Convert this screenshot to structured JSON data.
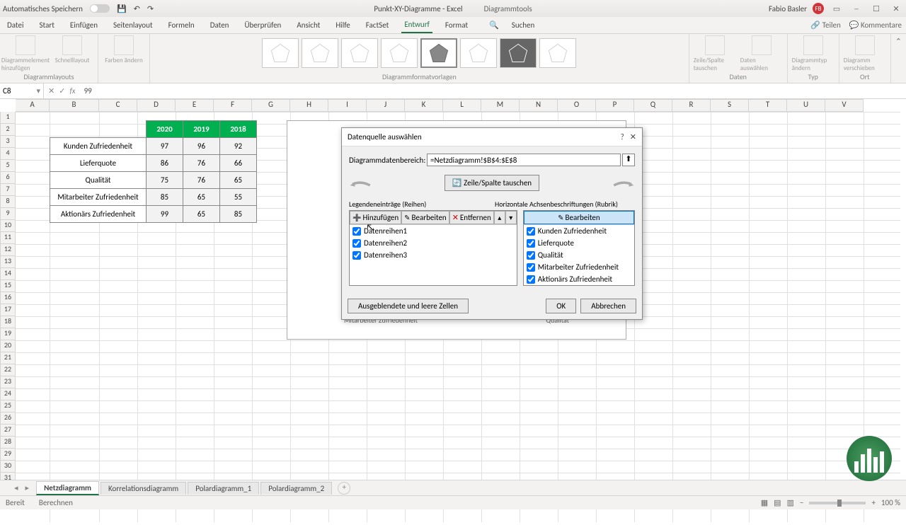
{
  "titlebar": {
    "autosave": "Automatisches Speichern",
    "docname": "Punkt-XY-Diagramme - Excel",
    "context": "Diagrammtools",
    "user": "Fabio Basler",
    "initials": "FB"
  },
  "ribbon": {
    "tabs": [
      "Datei",
      "Start",
      "Einfügen",
      "Seitenlayout",
      "Formeln",
      "Daten",
      "Überprüfen",
      "Ansicht",
      "Hilfe",
      "FactSet",
      "Entwurf",
      "Format"
    ],
    "active_tab": "Entwurf",
    "search": "Suchen",
    "share": "Teilen",
    "comments": "Kommentare",
    "groups": {
      "layouts": "Diagrammlayouts",
      "styles": "Diagrammformatvorlagen",
      "data": "Daten",
      "type": "Typ",
      "loc": "Ort"
    },
    "btns": {
      "add_elem": "Diagrammelement hinzufügen",
      "quick": "Schnelllayout",
      "colors": "Farben ändern",
      "switch": "Zeile/Spalte tauschen",
      "select_data": "Daten auswählen",
      "change_type": "Diagrammtyp ändern",
      "move": "Diagramm verschieben"
    }
  },
  "fxbar": {
    "name": "C8",
    "value": "99"
  },
  "columns": [
    "A",
    "B",
    "C",
    "D",
    "E",
    "F",
    "G",
    "H",
    "I",
    "J",
    "K",
    "L",
    "M",
    "N",
    "O",
    "P",
    "Q",
    "R",
    "S",
    "T",
    "U",
    "V"
  ],
  "chart_data": {
    "type": "radar",
    "categories": [
      "Kunden Zufriedenheit",
      "Lieferquote",
      "Qualität",
      "Mitarbeiter Zufriedenheit",
      "Aktionärs Zufriedenheit"
    ],
    "series": [
      {
        "name": "2020",
        "values": [
          97,
          86,
          75,
          85,
          99
        ]
      },
      {
        "name": "2019",
        "values": [
          96,
          76,
          76,
          65,
          65
        ]
      },
      {
        "name": "2018",
        "values": [
          92,
          66,
          65,
          55,
          85
        ]
      }
    ],
    "title": "",
    "axis_labels_visible": [
      "Mitarbeiter Zufriedenheit",
      "Qualität"
    ]
  },
  "dialog": {
    "title": "Datenquelle auswählen",
    "range_label": "Diagrammdatenbereich:",
    "range_value": "=Netzdiagramm!$B$4:$E$8",
    "switch": "Zeile/Spalte tauschen",
    "left_header": "Legendeneinträge (Reihen)",
    "right_header": "Horizontale Achsenbeschriftungen (Rubrik)",
    "add": "Hinzufügen",
    "edit": "Bearbeiten",
    "remove": "Entfernen",
    "series": [
      "Datenreihen1",
      "Datenreihen2",
      "Datenreihen3"
    ],
    "categories": [
      "Kunden Zufriedenheit",
      "Lieferquote",
      "Qualität",
      "Mitarbeiter Zufriedenheit",
      "Aktionärs Zufriedenheit"
    ],
    "hidden": "Ausgeblendete und leere Zellen",
    "ok": "OK",
    "cancel": "Abbrechen"
  },
  "sheets": {
    "tabs": [
      "Netzdiagramm",
      "Korrelationsdiagramm",
      "Polardiagramm_1",
      "Polardiagramm_2"
    ],
    "active": "Netzdiagramm"
  },
  "status": {
    "ready": "Bereit",
    "calc": "Berechnen",
    "zoom": "100 %"
  },
  "chart_labels": {
    "mit": "Mitarbeiter Zufriedenheit",
    "qual": "Qualität"
  }
}
